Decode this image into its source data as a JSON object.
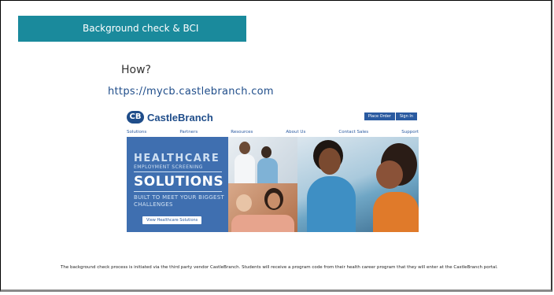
{
  "slide": {
    "header_title": "Background check & BCI",
    "question": "How?",
    "url": "https://mycb.castlebranch.com",
    "caption": "The background check process is initiated via the third party vendor CastleBranch.  Students will receive a program code from their health career program that they will enter at the CastleBranch portal."
  },
  "website": {
    "logo_mark": "CB",
    "logo_text": "CastleBranch",
    "top_buttons": [
      "Place Order",
      "Sign In"
    ],
    "nav": [
      "Solutions",
      "Partners",
      "Resources",
      "About Us",
      "Contact Sales",
      "Support"
    ],
    "hero": {
      "line1": "HEALTHCARE",
      "line2": "EMPLOYMENT SCREENING",
      "line3": "SOLUTIONS",
      "line4": "BUILT TO MEET YOUR BIGGEST CHALLENGES",
      "button": "View Healthcare Solutions"
    }
  },
  "colors": {
    "header_bg": "#1a8a9c",
    "brand_blue": "#1f4d8a",
    "hero_blue": "#3f6fb0"
  }
}
